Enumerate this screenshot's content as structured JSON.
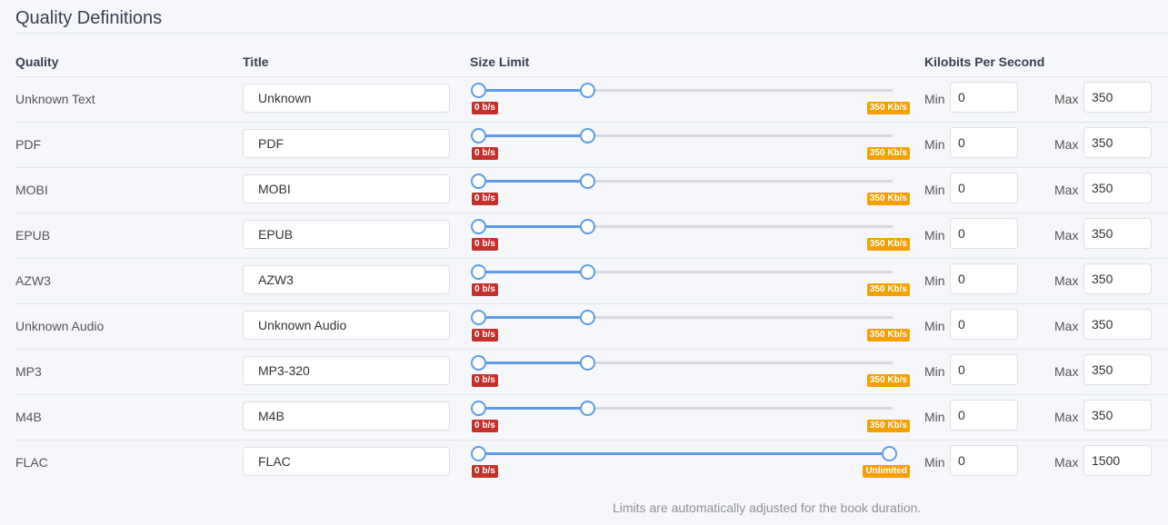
{
  "legend": "Quality Definitions",
  "headers": {
    "quality": "Quality",
    "title": "Title",
    "size_limit": "Size Limit",
    "kbps": "Kilobits Per Second"
  },
  "labels": {
    "min": "Min",
    "max": "Max"
  },
  "colors": {
    "accent": "#5d9cec",
    "min_badge": "#c4302b",
    "max_badge": "#f5a000"
  },
  "rows": [
    {
      "quality": "Unknown Text",
      "title": "Unknown",
      "min_label": "0 b/s",
      "max_label": "350 Kb/s",
      "min_frac": 0,
      "max_frac": 0.265,
      "min": "0",
      "max": "350"
    },
    {
      "quality": "PDF",
      "title": "PDF",
      "min_label": "0 b/s",
      "max_label": "350 Kb/s",
      "min_frac": 0,
      "max_frac": 0.265,
      "min": "0",
      "max": "350"
    },
    {
      "quality": "MOBI",
      "title": "MOBI",
      "min_label": "0 b/s",
      "max_label": "350 Kb/s",
      "min_frac": 0,
      "max_frac": 0.265,
      "min": "0",
      "max": "350"
    },
    {
      "quality": "EPUB",
      "title": "EPUB",
      "min_label": "0 b/s",
      "max_label": "350 Kb/s",
      "min_frac": 0,
      "max_frac": 0.265,
      "min": "0",
      "max": "350"
    },
    {
      "quality": "AZW3",
      "title": "AZW3",
      "min_label": "0 b/s",
      "max_label": "350 Kb/s",
      "min_frac": 0,
      "max_frac": 0.265,
      "min": "0",
      "max": "350"
    },
    {
      "quality": "Unknown Audio",
      "title": "Unknown Audio",
      "min_label": "0 b/s",
      "max_label": "350 Kb/s",
      "min_frac": 0,
      "max_frac": 0.265,
      "min": "0",
      "max": "350"
    },
    {
      "quality": "MP3",
      "title": "MP3-320",
      "min_label": "0 b/s",
      "max_label": "350 Kb/s",
      "min_frac": 0,
      "max_frac": 0.265,
      "min": "0",
      "max": "350"
    },
    {
      "quality": "M4B",
      "title": "M4B",
      "min_label": "0 b/s",
      "max_label": "350 Kb/s",
      "min_frac": 0,
      "max_frac": 0.265,
      "min": "0",
      "max": "350"
    },
    {
      "quality": "FLAC",
      "title": "FLAC",
      "min_label": "0 b/s",
      "max_label": "Unlimited",
      "min_frac": 0,
      "max_frac": 1.0,
      "min": "0",
      "max": "1500"
    }
  ],
  "help_text": "Limits are automatically adjusted for the book duration."
}
